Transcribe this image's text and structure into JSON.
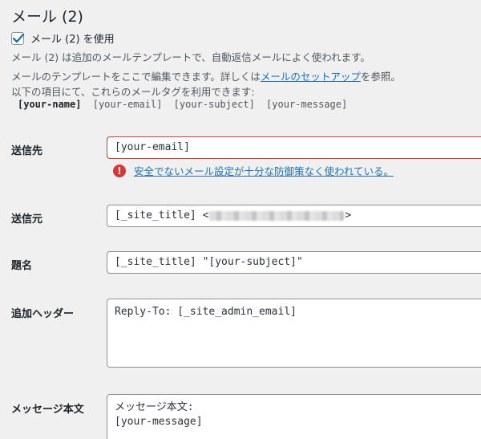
{
  "panel": {
    "title": "メール (2)",
    "enable_checkbox": {
      "label": "メール (2) を使用",
      "checked": true
    },
    "description": "メール (2) は追加のメールテンプレートで、自動返信メールによく使われます。",
    "edit_note_prefix": "メールのテンプレートをここで編集できます。詳しくは",
    "edit_note_link": "メールのセットアップ",
    "edit_note_suffix": "を参照。",
    "tags_note": "以下の項目にて、これらのメールタグを利用できます:",
    "mail_tags": [
      {
        "tag": "[your-name]",
        "used": true
      },
      {
        "tag": "[your-email]",
        "used": false
      },
      {
        "tag": "[your-subject]",
        "used": false
      },
      {
        "tag": "[your-message]",
        "used": false
      }
    ]
  },
  "fields": {
    "to": {
      "label": "送信先",
      "value": "[your-email]",
      "has_error": true
    },
    "to_warning": "安全でないメール設定が十分な防御策なく使われている。",
    "from": {
      "label": "送信元",
      "value_prefix": "[_site_title] <",
      "value_suffix": ">"
    },
    "subject": {
      "label": "題名",
      "value": "[_site_title] \"[your-subject]\""
    },
    "headers": {
      "label": "追加ヘッダー",
      "value": "Reply-To: [_site_admin_email]"
    },
    "body": {
      "label": "メッセージ本文",
      "lines": [
        "メッセージ本文:",
        "[your-message]"
      ]
    }
  },
  "colors": {
    "error": "#d63638",
    "link": "#2271b1",
    "background": "#f0f0f1"
  },
  "icons": {
    "checkbox": "checkmark-icon",
    "warning": "exclamation-circle-icon"
  }
}
